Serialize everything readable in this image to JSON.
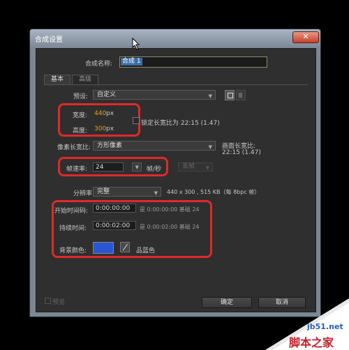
{
  "window": {
    "title": "合成设置",
    "close_symbol": "✕"
  },
  "comp_name": {
    "label": "合成名称:",
    "value": "合成 1"
  },
  "tabs": [
    {
      "label": "基本"
    },
    {
      "label": "高级"
    }
  ],
  "preset": {
    "label": "预设:",
    "value": "自定义"
  },
  "width": {
    "label": "宽度:",
    "value": "440",
    "unit": "px"
  },
  "height": {
    "label": "高度:",
    "value": "300",
    "unit": "px"
  },
  "lock_aspect": {
    "label": "锁定长宽比为 22:15 (1.47)"
  },
  "pixel_aspect": {
    "label": "像素长宽比:",
    "value": "方形像素"
  },
  "frame_aspect": {
    "label": "画面长宽比:",
    "value": "22:15 (1.47)"
  },
  "frame_rate": {
    "label": "帧速率:",
    "value": "24",
    "unit": "帧/秒",
    "drop_frame": "丢帧"
  },
  "resolution": {
    "label": "分辨率:",
    "value": "完整",
    "info": "440 x 300 , 515 KB（每 8bpc 帧）"
  },
  "start_timecode": {
    "label": "开始时间码:",
    "value": "0:00:00:00",
    "info": "是 0:00:00:00  基础 24"
  },
  "duration": {
    "label": "持续时间:",
    "value": "0:00:02:00",
    "info": "是 0:00:02:00  基础 24"
  },
  "bg_color": {
    "label": "背景颜色:",
    "name": "品蓝色",
    "swatch": "#2a56d4"
  },
  "preview": {
    "label": "预览"
  },
  "buttons": {
    "ok": "确定",
    "cancel": "取消"
  },
  "watermark": {
    "site": "jb51.net",
    "name": "脚本之家"
  }
}
